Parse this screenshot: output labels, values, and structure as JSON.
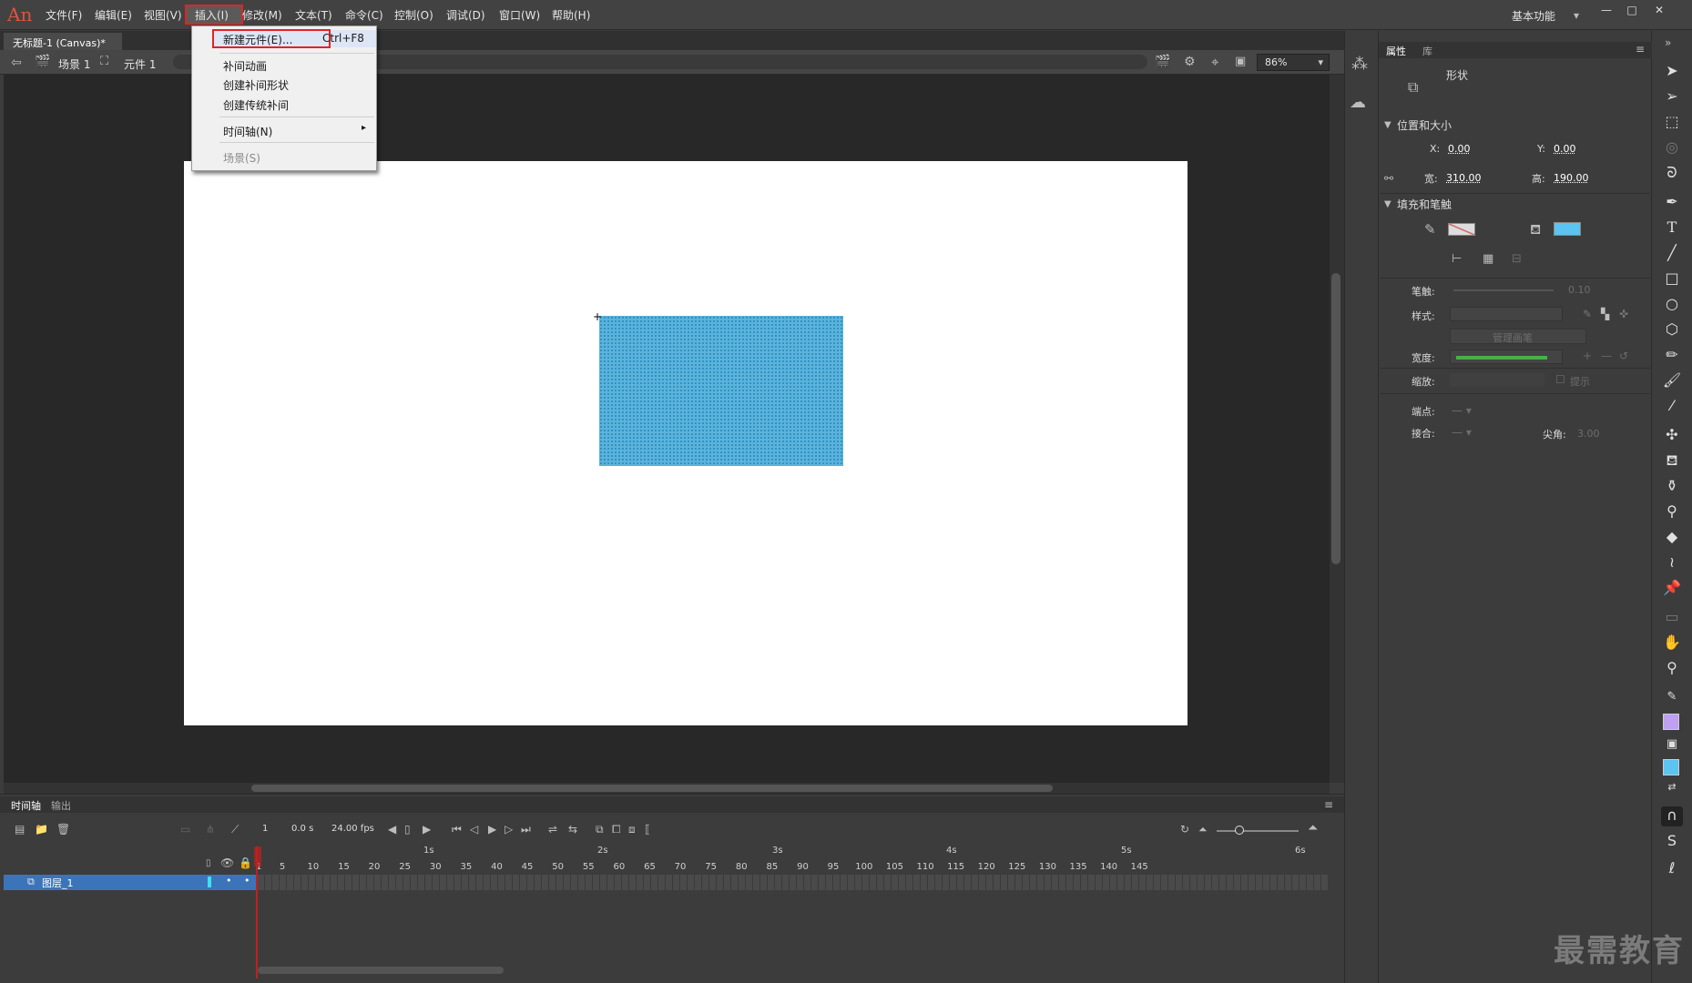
{
  "app": {
    "logo": "An"
  },
  "menubar": {
    "items": [
      "文件(F)",
      "编辑(E)",
      "视图(V)",
      "插入(I)",
      "修改(M)",
      "文本(T)",
      "命令(C)",
      "控制(O)",
      "调试(D)",
      "窗口(W)",
      "帮助(H)"
    ],
    "workspace": "基本功能",
    "window_controls": [
      "—",
      "□",
      "✕"
    ]
  },
  "document": {
    "tab_title": "无标题-1 (Canvas)*",
    "tab_close": "×",
    "scene": "场景 1",
    "symbol": "元件 1",
    "zoom": "86%"
  },
  "insert_menu": {
    "items": [
      {
        "label": "新建元件(E)...",
        "shortcut": "Ctrl+F8"
      },
      {
        "label": "补间动画"
      },
      {
        "label": "创建补间形状"
      },
      {
        "label": "创建传统补间"
      },
      {
        "label": "时间轴(N)",
        "submenu_arrow": "▸"
      },
      {
        "label": "场景(S)"
      }
    ]
  },
  "properties": {
    "tabs": [
      "属性",
      "库"
    ],
    "object_type": "形状",
    "position_size": {
      "header": "位置和大小",
      "x_label": "X:",
      "x": "0.00",
      "y_label": "Y:",
      "y": "0.00",
      "w_label": "宽:",
      "w": "310.00",
      "h_label": "高:",
      "h": "190.00"
    },
    "fill_stroke": {
      "header": "填充和笔触",
      "stroke_label": "笔触:",
      "stroke_value": "0.10",
      "style_label": "样式:",
      "manage_brushes": "管理画笔",
      "width_label": "宽度:",
      "scale_label": "缩放:",
      "hint_label": "提示",
      "cap_label": "端点:",
      "join_label": "接合:",
      "miter_label": "尖角:",
      "miter_value": "3.00",
      "fill_color": "#5bc4f0",
      "stroke_color": "#d46a6a"
    }
  },
  "timeline": {
    "tabs": [
      "时间轴",
      "输出"
    ],
    "current_frame": "1",
    "elapsed": "0.0 s",
    "fps": "24.00 fps",
    "seconds": [
      "1s",
      "2s",
      "3s",
      "4s",
      "5s",
      "6s"
    ],
    "frame_ticks": [
      "1",
      "5",
      "10",
      "15",
      "20",
      "25",
      "30",
      "35",
      "40",
      "45",
      "50",
      "55",
      "60",
      "65",
      "70",
      "75",
      "80",
      "85",
      "90",
      "95",
      "100",
      "105",
      "110",
      "115",
      "120",
      "125",
      "130",
      "135",
      "140",
      "145"
    ],
    "layer_name": "图层_1"
  },
  "watermark": "最需教育",
  "tool_icons": [
    "selection-icon",
    "subselection-icon",
    "free-transform-icon",
    "3d-rotation-icon",
    "lasso-icon",
    "pen-icon",
    "text-icon",
    "line-icon",
    "rectangle-icon",
    "oval-icon",
    "polystar-icon",
    "pencil-icon",
    "paint-brush-icon",
    "brush-icon",
    "bone-icon",
    "paint-bucket-icon",
    "ink-bottle-icon",
    "eyedropper-icon",
    "eraser-icon",
    "width-icon",
    "pin-icon",
    "camera-icon",
    "hand-icon",
    "zoom-icon"
  ]
}
